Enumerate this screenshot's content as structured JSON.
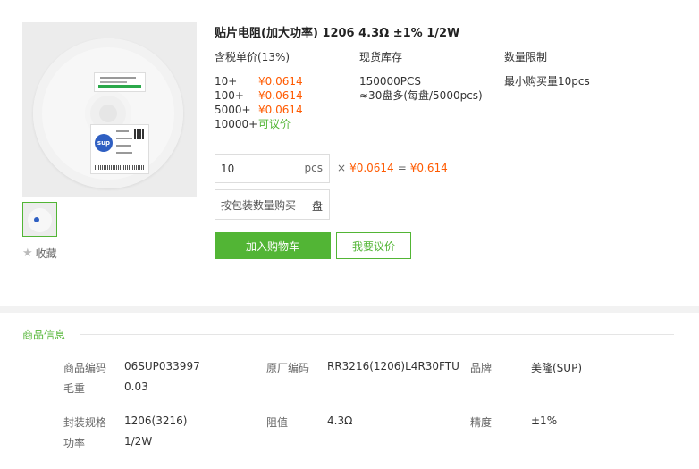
{
  "product": {
    "title": "贴片电阻(加大功率) 1206 4.3Ω ±1% 1/2W",
    "favorite_label": "收藏",
    "image_label": "sup"
  },
  "pricing": {
    "header": "含税单价(13%)",
    "tiers": [
      {
        "qty": "10+",
        "price": "¥0.0614"
      },
      {
        "qty": "100+",
        "price": "¥0.0614"
      },
      {
        "qty": "5000+",
        "price": "¥0.0614"
      },
      {
        "qty": "10000+",
        "price": "可议价"
      }
    ]
  },
  "stock": {
    "header": "现货库存",
    "line1": "150000PCS",
    "line2": "≈30盘多(每盘/5000pcs)"
  },
  "limit": {
    "header": "数量限制",
    "text": "最小购买量10pcs"
  },
  "order": {
    "quantity_value": "10",
    "quantity_unit": "pcs",
    "times": "×",
    "unit_price": "¥0.0614",
    "equals": "=",
    "total": "¥0.614",
    "pack_placeholder": "按包装数量购买",
    "pack_unit": "盘",
    "add_to_cart": "加入购物车",
    "quote": "我要议价"
  },
  "info": {
    "section_title": "商品信息",
    "attributes": [
      {
        "key": "商品编码",
        "value": "06SUP033997"
      },
      {
        "key": "原厂编码",
        "value": "RR3216(1206)L4R30FTU"
      },
      {
        "key": "品牌",
        "value": "美隆(SUP)"
      },
      {
        "key": "毛重",
        "value": "0.03"
      },
      {
        "key": "封装规格",
        "value": "1206(3216)"
      },
      {
        "key": "阻值",
        "value": "4.3Ω"
      },
      {
        "key": "精度",
        "value": "±1%"
      },
      {
        "key": "功率",
        "value": "1/2W"
      }
    ]
  },
  "colors": {
    "accent_green": "#52b535",
    "price_orange": "#ff5a00"
  }
}
